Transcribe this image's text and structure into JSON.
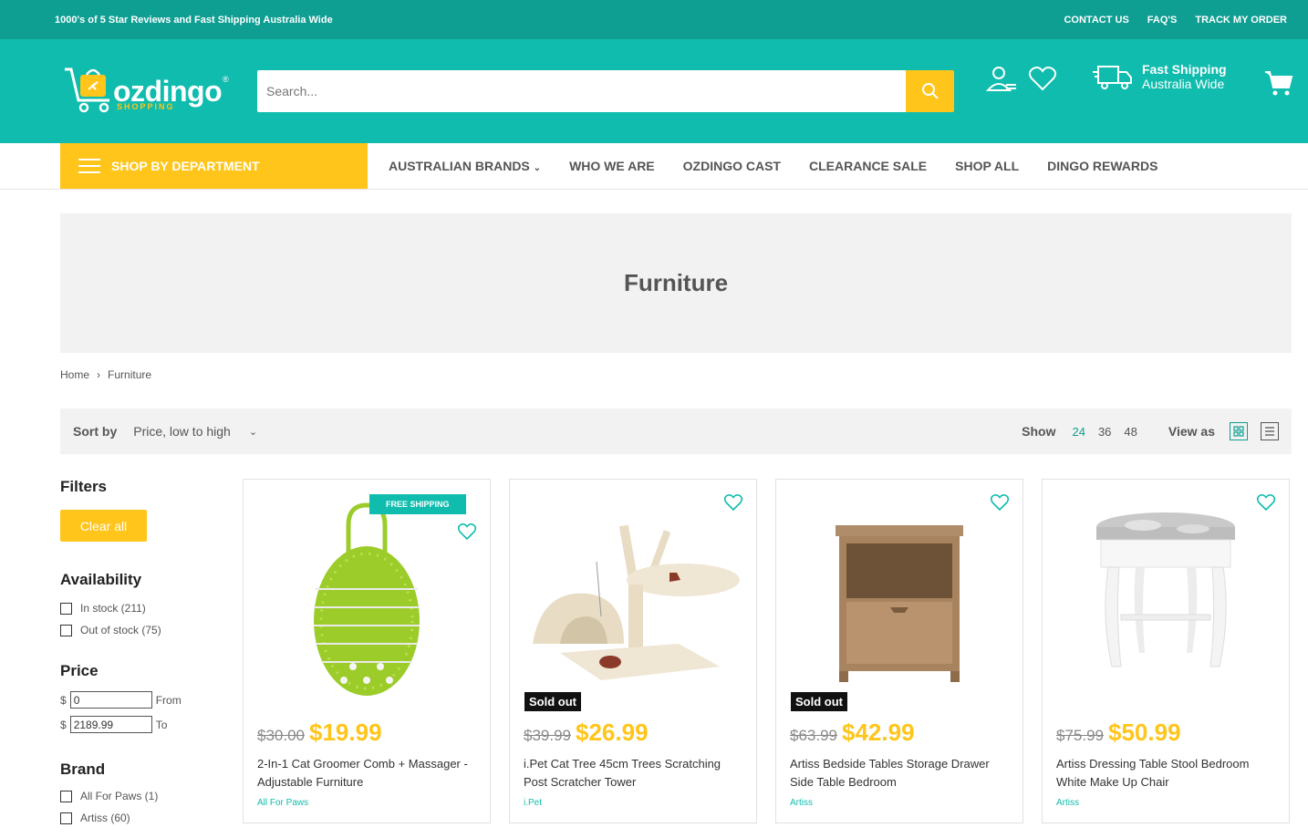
{
  "topbar": {
    "promo": "1000's of 5 Star Reviews and Fast Shipping Australia Wide",
    "links": [
      "CONTACT US",
      "FAQ'S",
      "TRACK MY ORDER"
    ]
  },
  "header": {
    "logo_word": "ozdingo",
    "logo_sub": "SHOPPING",
    "logo_reg": "®",
    "search_placeholder": "Search...",
    "shipping_title": "Fast Shipping",
    "shipping_sub": "Australia Wide"
  },
  "nav": {
    "department": "SHOP BY DEPARTMENT",
    "links": [
      "AUSTRALIAN BRANDS",
      "WHO WE ARE",
      "OZDINGO CAST",
      "CLEARANCE SALE",
      "SHOP ALL",
      "DINGO REWARDS"
    ]
  },
  "hero": {
    "title": "Furniture"
  },
  "breadcrumb": {
    "home": "Home",
    "current": "Furniture"
  },
  "sortbar": {
    "sort_label": "Sort by",
    "sort_value": "Price, low to high",
    "show_label": "Show",
    "show_options": [
      "24",
      "36",
      "48"
    ],
    "view_label": "View as"
  },
  "filters": {
    "title": "Filters",
    "clear_label": "Clear all",
    "availability": {
      "title": "Availability",
      "options": [
        "In stock (211)",
        "Out of stock (75)"
      ]
    },
    "price": {
      "title": "Price",
      "currency": "$",
      "from_value": "0",
      "from_label": "From",
      "to_value": "2189.99",
      "to_label": "To"
    },
    "brand": {
      "title": "Brand",
      "options": [
        "All For Paws (1)",
        "Artiss (60)"
      ]
    }
  },
  "products": [
    {
      "badge": "FREE SHIPPING",
      "old_price": "$30.00",
      "price": "$19.99",
      "title": "2-In-1 Cat Groomer Comb + Massager - Adjustable Furniture",
      "brand": "All For Paws"
    },
    {
      "sold_out": "Sold out",
      "old_price": "$39.99",
      "price": "$26.99",
      "title": "i.Pet Cat Tree 45cm Trees Scratching Post Scratcher Tower",
      "brand": "i.Pet"
    },
    {
      "sold_out": "Sold out",
      "old_price": "$63.99",
      "price": "$42.99",
      "title": "Artiss Bedside Tables Storage Drawer Side Table Bedroom",
      "brand": "Artiss"
    },
    {
      "old_price": "$75.99",
      "price": "$50.99",
      "title": "Artiss Dressing Table Stool Bedroom White Make Up Chair",
      "brand": "Artiss"
    }
  ],
  "colors": {
    "teal": "#0fbcad",
    "teal_dark": "#0e9e92",
    "yellow": "#ffc51a"
  }
}
